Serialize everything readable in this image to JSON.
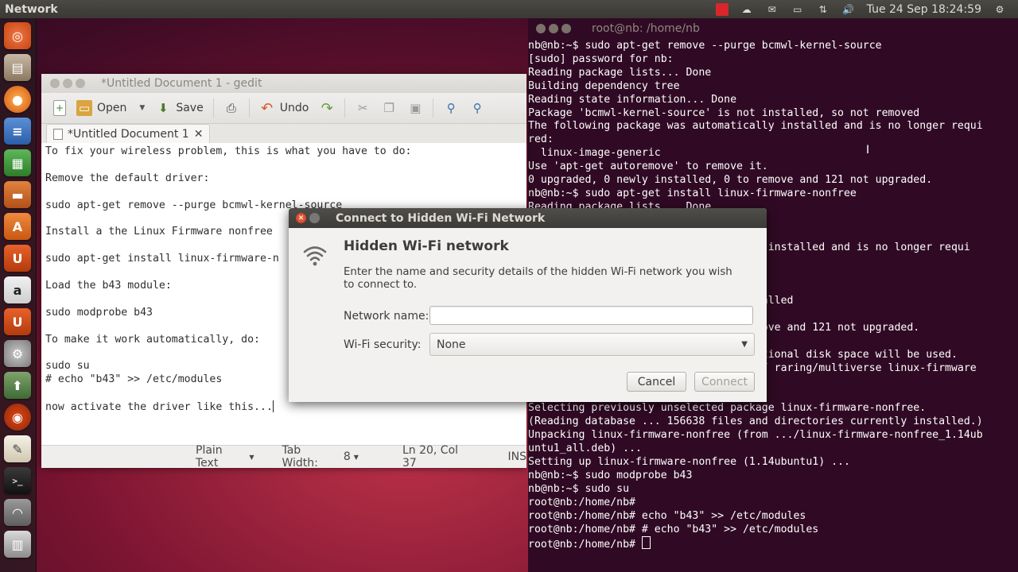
{
  "topbar": {
    "app_name": "Network",
    "datetime": "Tue 24 Sep  18:24:59"
  },
  "launcher": {
    "items": [
      {
        "name": "dash-home",
        "icon": "ubuntu-logo-icon"
      },
      {
        "name": "files",
        "icon": "folder-icon"
      },
      {
        "name": "firefox",
        "icon": "firefox-icon"
      },
      {
        "name": "libreoffice-writer",
        "icon": "writer-icon"
      },
      {
        "name": "libreoffice-calc",
        "icon": "calc-icon"
      },
      {
        "name": "libreoffice-impress",
        "icon": "impress-icon"
      },
      {
        "name": "software-center",
        "icon": "software-center-icon"
      },
      {
        "name": "ubuntu-one",
        "icon": "ubuntu-one-icon"
      },
      {
        "name": "amazon",
        "icon": "amazon-icon"
      },
      {
        "name": "ubuntu-one-music",
        "icon": "ubuntu-one-icon"
      },
      {
        "name": "system-settings",
        "icon": "gear-icon"
      },
      {
        "name": "software-updater",
        "icon": "update-icon"
      },
      {
        "name": "ubuntu",
        "icon": "ubuntu-logo-icon"
      },
      {
        "name": "gedit",
        "icon": "text-editor-icon"
      },
      {
        "name": "terminal",
        "icon": "terminal-icon"
      },
      {
        "name": "network",
        "icon": "wifi-icon"
      },
      {
        "name": "trash",
        "icon": "trash-icon"
      }
    ]
  },
  "terminal": {
    "title": "root@nb: /home/nb",
    "lines": [
      "nb@nb:~$ sudo apt-get remove --purge bcmwl-kernel-source",
      "[sudo] password for nb:",
      "Reading package lists... Done",
      "Building dependency tree",
      "Reading state information... Done",
      "Package 'bcmwl-kernel-source' is not installed, so not removed",
      "The following package was automatically installed and is no longer requi",
      "red:",
      "  linux-image-generic",
      "Use 'apt-get autoremove' to remove it.",
      "0 upgraded, 0 newly installed, 0 to remove and 121 not upgraded.",
      "nb@nb:~$ sudo apt-get install linux-firmware-nonfree",
      "Reading package lists... Done",
      "",
      "",
      "                                  lly installed and is no longer requi",
      "",
      "",
      "                                  t.",
      "                                  nstalled",
      "",
      "                                  remove and 121 not upgraded.",
      "",
      "                                  dditional disk space will be used.",
      "                                  ntu/ raring/multiverse linux-firmware",
      "",
      "",
      "Selecting previously unselected package linux-firmware-nonfree.",
      "(Reading database ... 156638 files and directories currently installed.)",
      "Unpacking linux-firmware-nonfree (from .../linux-firmware-nonfree_1.14ub",
      "untu1_all.deb) ...",
      "Setting up linux-firmware-nonfree (1.14ubuntu1) ...",
      "nb@nb:~$ sudo modprobe b43",
      "nb@nb:~$ sudo su",
      "root@nb:/home/nb#",
      "root@nb:/home/nb# echo \"b43\" >> /etc/modules",
      "root@nb:/home/nb# # echo \"b43\" >> /etc/modules"
    ],
    "prompt": "root@nb:/home/nb# "
  },
  "gedit": {
    "title": "*Untitled Document 1 - gedit",
    "toolbar": {
      "open_label": "Open",
      "save_label": "Save",
      "undo_label": "Undo"
    },
    "tab_label": "*Untitled Document 1",
    "lines": [
      "To fix your wireless problem, this is what you have to do:",
      "",
      "Remove the default driver:",
      "",
      "sudo apt-get remove --purge bcmwl-kernel-source",
      "",
      "Install a the Linux Firmware nonfree",
      "",
      "sudo apt-get install linux-firmware-n",
      "",
      "Load the b43 module:",
      "",
      "sudo modprobe b43",
      "",
      "To make it work automatically, do:",
      "",
      "sudo su",
      "# echo \"b43\" >> /etc/modules",
      ""
    ],
    "last_line": "now activate the driver like this...",
    "status": {
      "language": "Plain Text",
      "tab_width_label": "Tab Width:",
      "tab_width_value": "8",
      "position": "Ln 20, Col 37",
      "mode": "INS"
    }
  },
  "dialog": {
    "title": "Connect to Hidden Wi-Fi Network",
    "heading": "Hidden Wi-Fi network",
    "description": "Enter the name and security details of the hidden Wi-Fi network you wish to connect to.",
    "network_name_label": "Network name:",
    "network_name_value": "",
    "security_label": "Wi-Fi security:",
    "security_value": "None",
    "cancel_label": "Cancel",
    "connect_label": "Connect"
  },
  "colors": {
    "terminal_bg": "#300a24",
    "panel_bg": "#3c3b37",
    "accent_orange": "#dd4814"
  }
}
